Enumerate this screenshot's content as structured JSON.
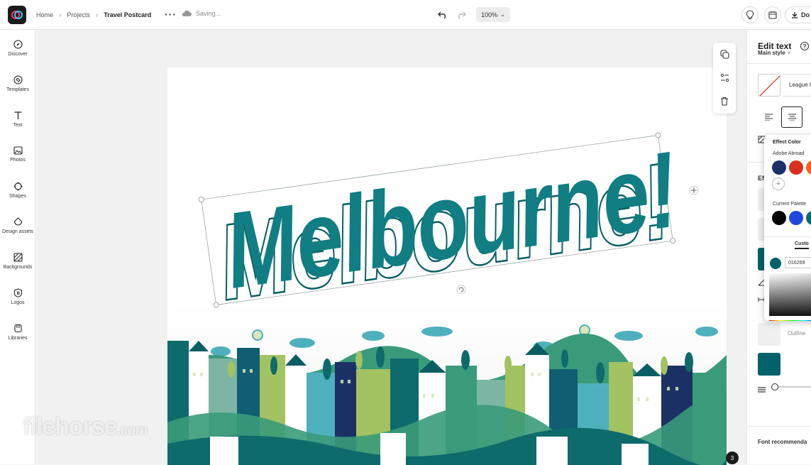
{
  "header": {
    "breadcrumb": [
      "Home",
      "Projects",
      "Travel Postcard"
    ],
    "saving": "Saving...",
    "zoom": "100%",
    "download_label": "Do"
  },
  "leftrail": {
    "items": [
      {
        "label": "Discover",
        "icon": "compass-icon"
      },
      {
        "label": "Templates",
        "icon": "templates-icon"
      },
      {
        "label": "Text",
        "icon": "text-icon"
      },
      {
        "label": "Photos",
        "icon": "photos-icon"
      },
      {
        "label": "Shapes",
        "icon": "shapes-icon"
      },
      {
        "label": "Design assets",
        "icon": "design-assets-icon"
      },
      {
        "label": "Backgrounds",
        "icon": "backgrounds-icon"
      },
      {
        "label": "Logos",
        "icon": "logos-icon"
      },
      {
        "label": "Libraries",
        "icon": "libraries-icon"
      }
    ]
  },
  "canvas": {
    "headline": "Melbourne!",
    "page_count": "3",
    "watermark": "filehorse",
    "watermark_suffix": ".com",
    "colors": {
      "teal": "#107e83",
      "outline": "#0a5e63"
    }
  },
  "rightpanel": {
    "title": "Edit text",
    "subtitle": "Main style",
    "font": "League G",
    "effects_label": "Ef",
    "outline_label": "Outline",
    "font_recommend": "Font recommenda",
    "teal_color": "#016269"
  },
  "effect_popover": {
    "title": "Effect Color",
    "group1": "Adobe Abroad",
    "group1_colors": [
      "#1b3166",
      "#d8301c",
      "#f0612a"
    ],
    "group2": "Current Palette",
    "group2_colors": [
      "#000000",
      "#1f47e0",
      "#0e6b6b"
    ],
    "custom_tab": "Custo",
    "hex_value": "016269",
    "current_color": "#016269"
  }
}
